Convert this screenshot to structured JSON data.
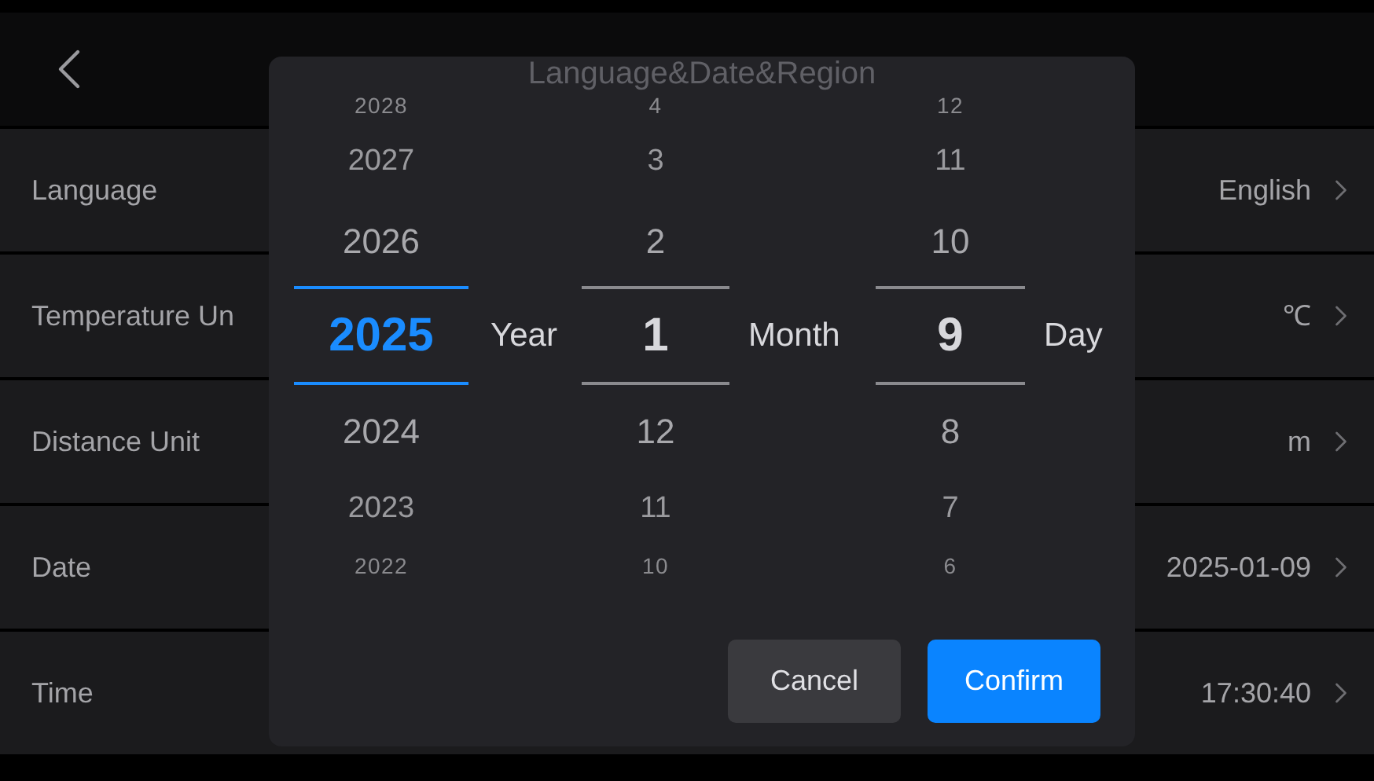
{
  "header": {
    "title": "Language&Date&Region"
  },
  "settings": [
    {
      "label": "Language",
      "value": "English"
    },
    {
      "label": "Temperature Un",
      "value": "℃"
    },
    {
      "label": "Distance Unit",
      "value": "m"
    },
    {
      "label": "Date",
      "value": "2025-01-09"
    },
    {
      "label": "Time",
      "value": "17:30:40"
    }
  ],
  "date_picker": {
    "columns": [
      {
        "unit": "Year",
        "accent": true,
        "items": [
          {
            "text": "2028",
            "selected": false
          },
          {
            "text": "2027",
            "selected": false
          },
          {
            "text": "2026",
            "selected": false
          },
          {
            "text": "2025",
            "selected": true
          },
          {
            "text": "2024",
            "selected": false
          },
          {
            "text": "2023",
            "selected": false
          },
          {
            "text": "2022",
            "selected": false
          }
        ]
      },
      {
        "unit": "Month",
        "accent": false,
        "items": [
          {
            "text": "4",
            "selected": false
          },
          {
            "text": "3",
            "selected": false
          },
          {
            "text": "2",
            "selected": false
          },
          {
            "text": "1",
            "selected": true
          },
          {
            "text": "12",
            "selected": false
          },
          {
            "text": "11",
            "selected": false
          },
          {
            "text": "10",
            "selected": false
          }
        ]
      },
      {
        "unit": "Day",
        "accent": false,
        "items": [
          {
            "text": "12",
            "selected": false
          },
          {
            "text": "11",
            "selected": false
          },
          {
            "text": "10",
            "selected": false
          },
          {
            "text": "9",
            "selected": true
          },
          {
            "text": "8",
            "selected": false
          },
          {
            "text": "7",
            "selected": false
          },
          {
            "text": "6",
            "selected": false
          }
        ]
      }
    ],
    "buttons": [
      {
        "label": "Cancel",
        "kind": "secondary"
      },
      {
        "label": "Confirm",
        "kind": "primary"
      }
    ]
  }
}
